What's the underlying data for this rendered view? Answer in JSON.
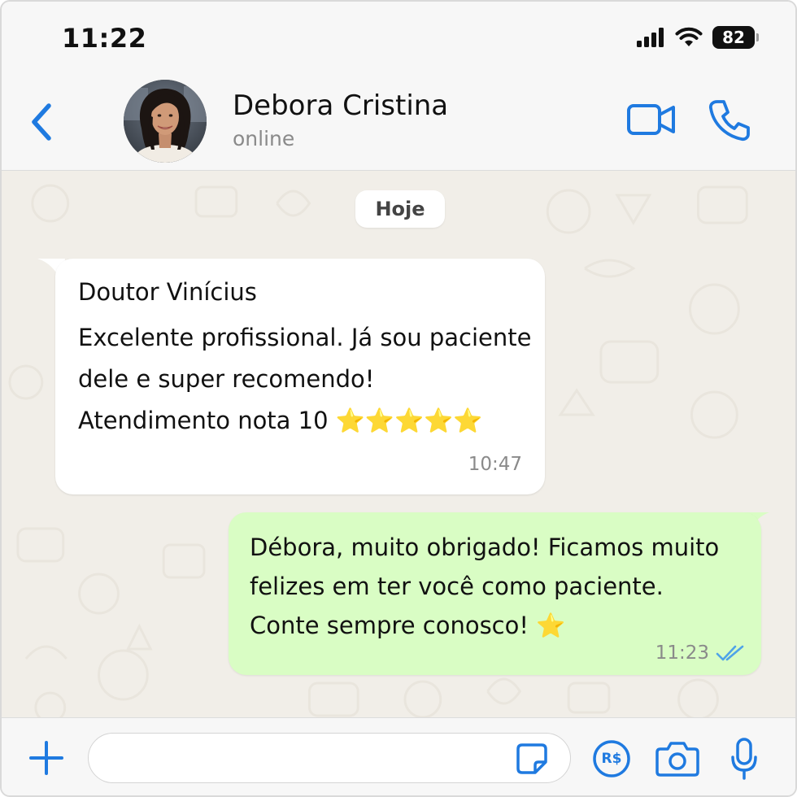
{
  "status_bar": {
    "time": "11:22",
    "battery": "82",
    "icons": [
      "signal-icon",
      "wifi-icon",
      "battery-icon"
    ]
  },
  "header": {
    "back_icon": "chevron-left-icon",
    "contact_name": "Debora Cristina",
    "contact_status": "online",
    "actions": [
      "video-call-icon",
      "phone-icon"
    ]
  },
  "chat": {
    "date_label": "Hoje",
    "messages": [
      {
        "direction": "incoming",
        "sender": "Doutor Vinícius",
        "lines": [
          "Excelente profissional. Já sou paciente",
          "dele e super recomendo!",
          "Atendimento nota 10 ⭐⭐⭐⭐⭐"
        ],
        "time": "10:47"
      },
      {
        "direction": "outgoing",
        "lines": [
          "Débora, muito obrigado! Ficamos muito",
          "felizes em ter você como paciente.",
          "Conte sempre conosco! ⭐"
        ],
        "time": "11:23",
        "status_icon": "double-check-icon"
      }
    ]
  },
  "composer": {
    "input_value": "",
    "input_placeholder": "",
    "pix_label": "R$",
    "icons": [
      "plus-icon",
      "sticker-icon",
      "pix-icon",
      "camera-icon",
      "mic-icon"
    ]
  },
  "colors": {
    "accent": "#1f7ae0",
    "incoming_bubble": "#ffffff",
    "outgoing_bubble": "#d9fdc4",
    "chat_background": "#f1eee8",
    "read_check": "#4fa3e8"
  }
}
